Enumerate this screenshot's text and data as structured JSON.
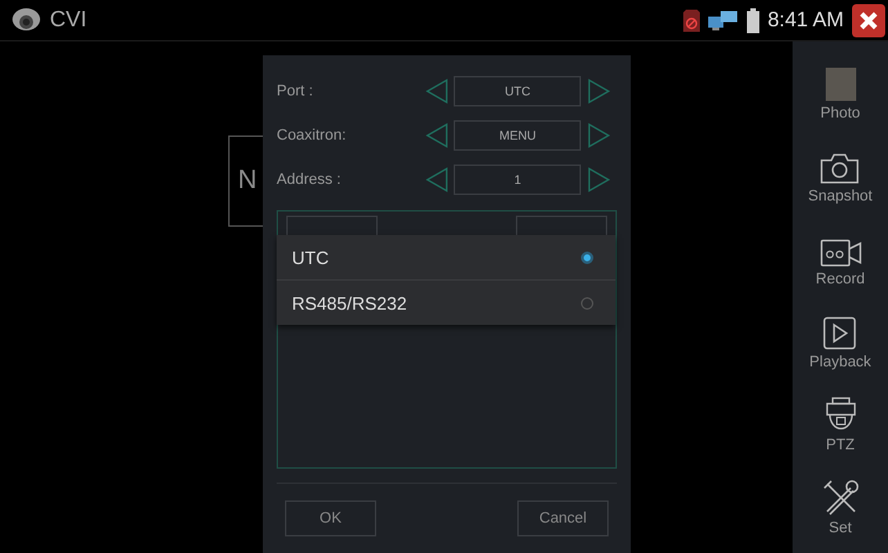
{
  "status_bar": {
    "app_title": "CVI",
    "time": "8:41 AM"
  },
  "video": {
    "message": "N"
  },
  "dialog": {
    "fields": [
      {
        "label": "Port :",
        "value": "UTC"
      },
      {
        "label": "Coaxitron:",
        "value": "MENU"
      },
      {
        "label": "Address :",
        "value": "1"
      }
    ],
    "buttons": [
      "OK",
      "Cancel"
    ]
  },
  "port_options": [
    {
      "label": "UTC",
      "selected": true
    },
    {
      "label": "RS485/RS232",
      "selected": false
    }
  ],
  "sidebar": [
    {
      "label": "Photo",
      "kind": "photo"
    },
    {
      "label": "Snapshot",
      "kind": "snapshot"
    },
    {
      "label": "Record",
      "kind": "record"
    },
    {
      "label": "Playback",
      "kind": "playback"
    },
    {
      "label": "PTZ",
      "kind": "ptz"
    },
    {
      "label": "Set",
      "kind": "set"
    }
  ]
}
